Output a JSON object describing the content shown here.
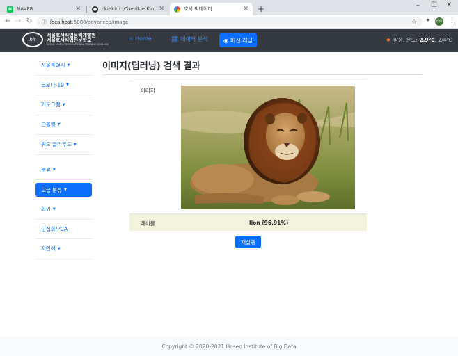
{
  "browser": {
    "tabs": [
      {
        "title": "NAVER",
        "favicon": "naver-icon"
      },
      {
        "title": "ckiekim (Cheolkie Kim)",
        "favicon": "github-icon"
      },
      {
        "title": "호서 빅데이터",
        "favicon": "pinwheel-icon"
      }
    ],
    "new_tab": "+",
    "window_controls": {
      "minimize": "–",
      "maximize": "☐",
      "close": "✕"
    },
    "url_host": "localhost",
    "url_path": ":5000/advanced/image",
    "avatar_text": "ckk"
  },
  "navbar": {
    "logo": {
      "line1": "서울호서직업능력개발원",
      "line2": "서울호서직업전문학교",
      "line3": "SEOUL HOSEO OCCUPATIONAL TRAINING COLLEGE"
    },
    "links": [
      {
        "label": "Home",
        "icon": "home-icon"
      },
      {
        "label": "데이터 분석",
        "icon": "chart-icon"
      },
      {
        "label": "머신 러닝",
        "icon": "brain-icon"
      }
    ],
    "weather": {
      "desc": "맑음, 온도:",
      "temp": "2.9℃",
      "range": ", 2/4℃"
    }
  },
  "sidebar": {
    "items": [
      {
        "label": "서울특별시"
      },
      {
        "label": "코로나-19"
      },
      {
        "label": "카토그램"
      },
      {
        "label": "크롤링"
      },
      {
        "label": "워드 클라우드"
      },
      {
        "label": "분류"
      },
      {
        "label": "고급 분류"
      },
      {
        "label": "회귀"
      },
      {
        "label": "군집화/PCA"
      },
      {
        "label": "자연어"
      }
    ]
  },
  "main": {
    "title": "이미지(딥러닝) 검색 결과",
    "image_label": "이미지",
    "result_label": "레이블",
    "result_value": "lion (96.91%)",
    "rerun_button": "재실행"
  },
  "footer": {
    "text": "Copyright © 2020-2021 Hoseo Institute of Big Data"
  },
  "colors": {
    "primary": "#0d6efd",
    "navbar": "#343a40",
    "result_row": "#f3f3dc"
  }
}
